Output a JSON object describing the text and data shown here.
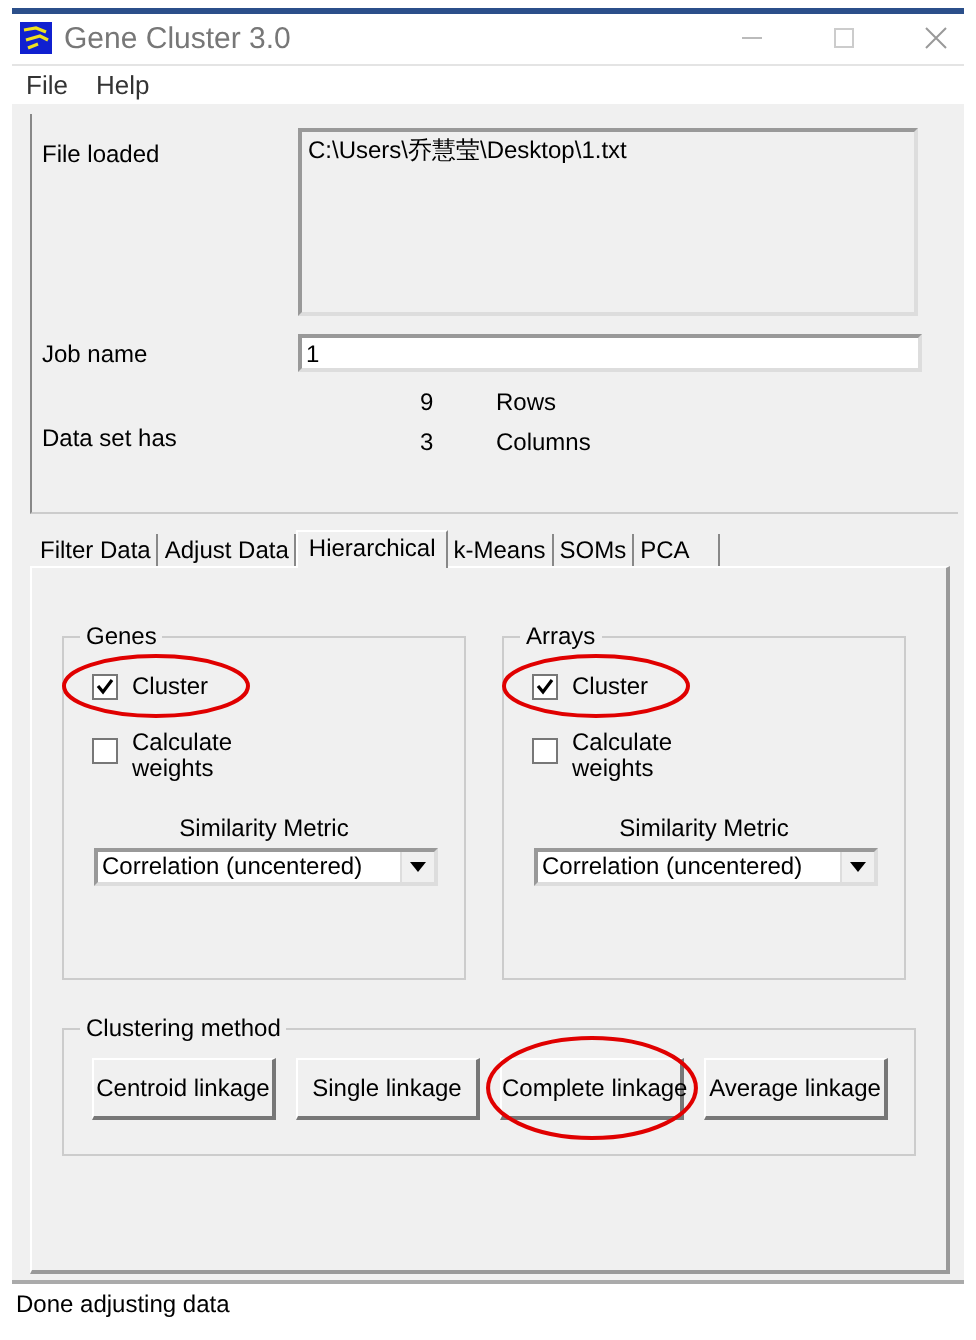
{
  "window": {
    "title": "Gene Cluster 3.0"
  },
  "menu": [
    "File",
    "Help"
  ],
  "file_loaded": {
    "label": "File loaded",
    "value": "C:\\Users\\乔慧莹\\Desktop\\1.txt"
  },
  "job_name": {
    "label": "Job name",
    "value": "1"
  },
  "data_set": {
    "label": "Data set has",
    "rows": {
      "count": "9",
      "label": "Rows"
    },
    "columns": {
      "count": "3",
      "label": "Columns"
    }
  },
  "tabs": [
    {
      "label": "Filter Data",
      "selected": false
    },
    {
      "label": "Adjust Data",
      "selected": false
    },
    {
      "label": "Hierarchical",
      "selected": true
    },
    {
      "label": "k-Means",
      "selected": false
    },
    {
      "label": "SOMs",
      "selected": false
    },
    {
      "label": "PCA",
      "selected": false
    }
  ],
  "groups": [
    {
      "title": "Genes",
      "cluster": {
        "label": "Cluster",
        "checked": true,
        "highlighted": true
      },
      "weights": {
        "label": "Calculate weights",
        "checked": false
      },
      "metric_label": "Similarity Metric",
      "metric": "Correlation (uncentered)"
    },
    {
      "title": "Arrays",
      "cluster": {
        "label": "Cluster",
        "checked": true,
        "highlighted": true
      },
      "weights": {
        "label": "Calculate weights",
        "checked": false
      },
      "metric_label": "Similarity Metric",
      "metric": "Correlation (uncentered)"
    }
  ],
  "clustering_method": {
    "title": "Clustering method",
    "buttons": [
      {
        "label": "Centroid linkage",
        "highlighted": false
      },
      {
        "label": "Single linkage",
        "highlighted": false
      },
      {
        "label": "Complete linkage",
        "highlighted": true
      },
      {
        "label": "Average linkage",
        "highlighted": false
      }
    ]
  },
  "status_bar": "Done adjusting data"
}
